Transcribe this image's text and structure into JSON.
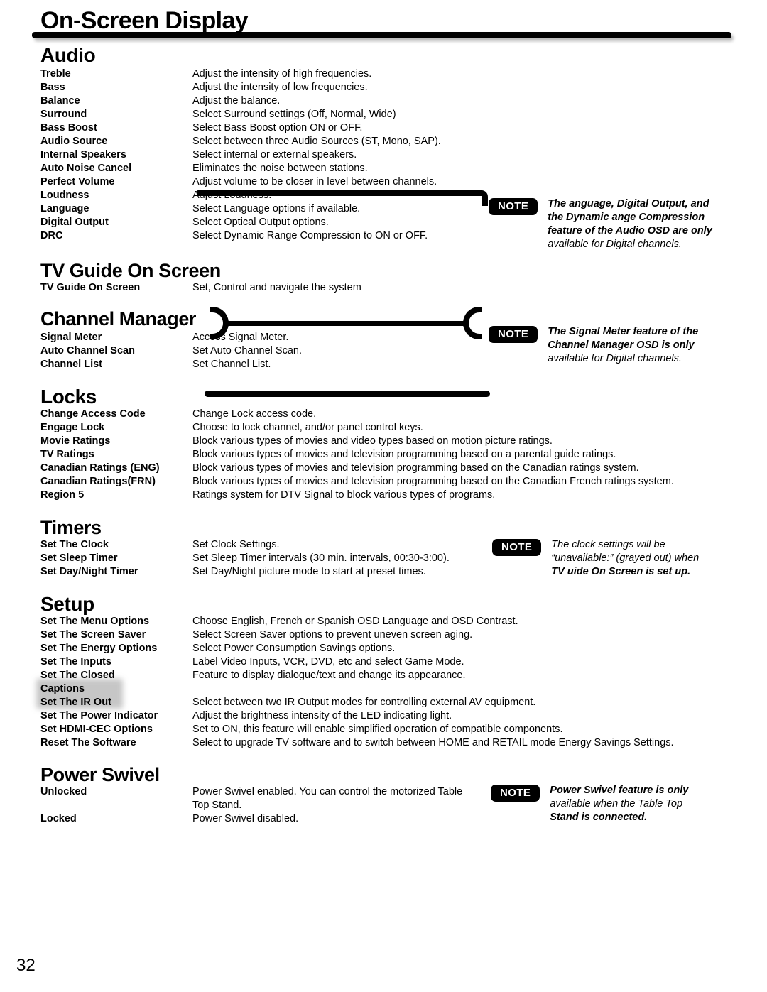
{
  "page_title": "On-Screen Display",
  "page_number": "32",
  "note_badge_label": "NOTE",
  "sections": [
    {
      "heading": "Audio",
      "rows": [
        {
          "label": "Treble",
          "desc": "Adjust the intensity of high frequencies."
        },
        {
          "label": "Bass",
          "desc": "Adjust the intensity of low frequencies."
        },
        {
          "label": "Balance",
          "desc": "Adjust the balance."
        },
        {
          "label": "Surround",
          "desc": "Select Surround settings (Off, Normal, Wide)"
        },
        {
          "label": "Bass Boost",
          "desc": "Select Bass Boost option ON or OFF."
        },
        {
          "label": "Audio Source",
          "desc": "Select between three Audio Sources (ST, Mono, SAP)."
        },
        {
          "label": "Internal Speakers",
          "desc": "Select internal or external speakers."
        },
        {
          "label": "Auto Noise Cancel",
          "desc": "Eliminates the noise between stations."
        },
        {
          "label": "Perfect Volume",
          "desc": "Adjust volume to be closer in level between channels."
        },
        {
          "label": "Loudness",
          "desc": "Adjust Loudness."
        },
        {
          "label": "Language",
          "desc": "Select Language options if available."
        },
        {
          "label": "Digital Output",
          "desc": "Select Optical Output options."
        },
        {
          "label": "DRC",
          "desc": "Select Dynamic Range Compression to ON or OFF."
        }
      ]
    },
    {
      "heading": "TV Guide On Screen",
      "rows": [
        {
          "label": "TV Guide On Screen",
          "desc": "Set, Control and navigate the system"
        }
      ]
    },
    {
      "heading": "Channel Manager",
      "rows": [
        {
          "label": "Signal Meter",
          "desc": "Access Signal Meter."
        },
        {
          "label": "Auto Channel Scan",
          "desc": "Set Auto Channel Scan."
        },
        {
          "label": "Channel List",
          "desc": "Set Channel List."
        }
      ]
    },
    {
      "heading": "Locks",
      "rows": [
        {
          "label": "Change Access Code",
          "desc": "Change Lock access code."
        },
        {
          "label": "Engage Lock",
          "desc": "Choose to lock channel, and/or panel control keys."
        },
        {
          "label": "Movie Ratings",
          "desc": "Block various types of movies and video types based on motion picture ratings."
        },
        {
          "label": "TV Ratings",
          "desc": "Block various types of movies and television programming based on a parental guide ratings."
        },
        {
          "label": "Canadian Ratings (ENG)",
          "desc": "Block various types of movies and television programming based on the Canadian ratings system."
        },
        {
          "label": "Canadian Ratings(FRN)",
          "desc": "Block various types of movies and television programming based on the Canadian French ratings system."
        },
        {
          "label": "Region 5",
          "desc": "Ratings system for DTV Signal to block various types of programs."
        }
      ]
    },
    {
      "heading": "Timers",
      "rows": [
        {
          "label": "Set The Clock",
          "desc": "Set Clock Settings."
        },
        {
          "label": "Set Sleep Timer",
          "desc": "Set Sleep Timer intervals (30 min. intervals, 00:30-3:00)."
        },
        {
          "label": "Set Day/Night Timer",
          "desc": "Set Day/Night picture mode to start at preset times."
        }
      ]
    },
    {
      "heading": "Setup",
      "rows": [
        {
          "label": "Set The Menu Options",
          "desc": "Choose English, French or Spanish OSD Language and OSD Contrast."
        },
        {
          "label": "Set The Screen Saver",
          "desc": "Select Screen Saver options to prevent uneven screen aging."
        },
        {
          "label": "Set The Energy Options",
          "desc": "Select Power Consumption Savings options."
        },
        {
          "label": "Set The Inputs",
          "desc": "Label Video Inputs, VCR, DVD, etc and select Game Mode."
        },
        {
          "label": "Set The Closed",
          "desc": "Feature to display dialogue/text and change its appearance."
        },
        {
          "label": "Captions",
          "desc": ""
        },
        {
          "label": "Set The IR Out",
          "desc": "Select between two IR Output modes for controlling external AV equipment."
        },
        {
          "label": "Set The Power Indicator",
          "desc": "Adjust the brightness intensity of the LED indicating light."
        },
        {
          "label": "Set HDMI-CEC Options",
          "desc": "Set to ON, this feature will enable simplified operation of compatible components."
        },
        {
          "label": "Reset The Software",
          "desc": "Select to upgrade TV software and to switch between HOME and RETAIL mode Energy Savings Settings."
        }
      ]
    },
    {
      "heading": "Power Swivel",
      "rows": [
        {
          "label": "Unlocked",
          "desc": "Power Swivel enabled. You can control the motorized Table Top Stand."
        },
        {
          "label": "Locked",
          "desc": "Power Swivel disabled."
        }
      ]
    }
  ],
  "notes": {
    "audio": {
      "line1": "The anguage, Digital Output, and",
      "line2": "the Dynamic ange Compression",
      "line3": "feature of the Audio OSD are only",
      "line4": "available for Digital channels."
    },
    "channel_manager": {
      "line1": "The Signal Meter feature of the",
      "line2": "Channel Manager OSD is only",
      "line3": "available for Digital channels."
    },
    "timers": {
      "line1": "The clock settings will be",
      "line2": "“unavailable:” (grayed out) when",
      "line3": "TV uide On Screen is set up."
    },
    "power_swivel": {
      "line1": "Power Swivel feature is only",
      "line2": "available when the Table Top",
      "line3": "Stand is connected."
    }
  }
}
